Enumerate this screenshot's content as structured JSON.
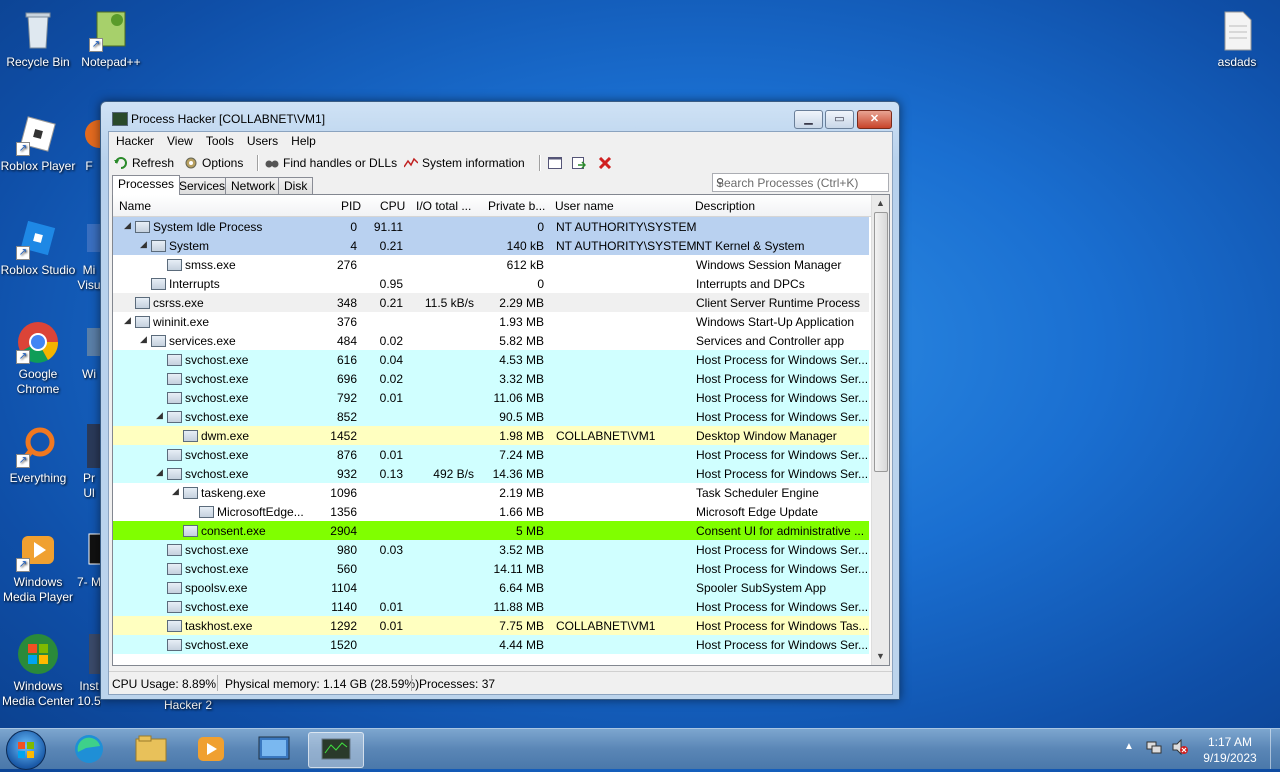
{
  "desktop": {
    "icons": [
      {
        "label": "Recycle Bin"
      },
      {
        "label": "Notepad++"
      },
      {
        "label": "asdads"
      },
      {
        "label": "Roblox Player"
      },
      {
        "label": "F"
      },
      {
        "label": "Roblox Studio"
      },
      {
        "label": "Mi Visu"
      },
      {
        "label": "Google Chrome"
      },
      {
        "label": "Wi"
      },
      {
        "label": "Everything"
      },
      {
        "label": "Pr Ul"
      },
      {
        "label": "Windows Media Player"
      },
      {
        "label": "7- M"
      },
      {
        "label": "Windows Media Center"
      },
      {
        "label": "Inst 10.5"
      },
      {
        "label": "Hacker 2"
      }
    ]
  },
  "window": {
    "title": "Process Hacker [COLLABNET\\VM1]",
    "menu": [
      "Hacker",
      "View",
      "Tools",
      "Users",
      "Help"
    ],
    "toolbar": {
      "refresh": "Refresh",
      "options": "Options",
      "find": "Find handles or DLLs",
      "sysinfo": "System information",
      "search_placeholder": "Search Processes (Ctrl+K)"
    },
    "tabs": [
      "Processes",
      "Services",
      "Network",
      "Disk"
    ],
    "columns": [
      "Name",
      "PID",
      "CPU",
      "I/O total ...",
      "Private b...",
      "User name",
      "Description"
    ],
    "rows": [
      {
        "name": "System Idle Process",
        "pid": "0",
        "cpu": "91.11",
        "io": "",
        "priv": "0",
        "user": "NT AUTHORITY\\SYSTEM",
        "desc": "",
        "indent": 1,
        "tri": true,
        "bg": "blue"
      },
      {
        "name": "System",
        "pid": "4",
        "cpu": "0.21",
        "io": "",
        "priv": "140 kB",
        "user": "NT AUTHORITY\\SYSTEM",
        "desc": "NT Kernel & System",
        "indent": 2,
        "tri": true,
        "bg": "blue"
      },
      {
        "name": "smss.exe",
        "pid": "276",
        "cpu": "",
        "io": "",
        "priv": "612 kB",
        "user": "",
        "desc": "Windows Session Manager",
        "indent": 3,
        "tri": false,
        "bg": "white"
      },
      {
        "name": "Interrupts",
        "pid": "",
        "cpu": "0.95",
        "io": "",
        "priv": "0",
        "user": "",
        "desc": "Interrupts and DPCs",
        "indent": 2,
        "tri": false,
        "bg": "white"
      },
      {
        "name": "csrss.exe",
        "pid": "348",
        "cpu": "0.21",
        "io": "11.5 kB/s",
        "priv": "2.29 MB",
        "user": "",
        "desc": "Client Server Runtime Process",
        "indent": 1,
        "tri": false,
        "bg": "gray"
      },
      {
        "name": "wininit.exe",
        "pid": "376",
        "cpu": "",
        "io": "",
        "priv": "1.93 MB",
        "user": "",
        "desc": "Windows Start-Up Application",
        "indent": 1,
        "tri": true,
        "bg": "white"
      },
      {
        "name": "services.exe",
        "pid": "484",
        "cpu": "0.02",
        "io": "",
        "priv": "5.82 MB",
        "user": "",
        "desc": "Services and Controller app",
        "indent": 2,
        "tri": true,
        "bg": "white"
      },
      {
        "name": "svchost.exe",
        "pid": "616",
        "cpu": "0.04",
        "io": "",
        "priv": "4.53 MB",
        "user": "",
        "desc": "Host Process for Windows Ser...",
        "indent": 3,
        "tri": false,
        "bg": "cyan"
      },
      {
        "name": "svchost.exe",
        "pid": "696",
        "cpu": "0.02",
        "io": "",
        "priv": "3.32 MB",
        "user": "",
        "desc": "Host Process for Windows Ser...",
        "indent": 3,
        "tri": false,
        "bg": "cyan"
      },
      {
        "name": "svchost.exe",
        "pid": "792",
        "cpu": "0.01",
        "io": "",
        "priv": "11.06 MB",
        "user": "",
        "desc": "Host Process for Windows Ser...",
        "indent": 3,
        "tri": false,
        "bg": "cyan"
      },
      {
        "name": "svchost.exe",
        "pid": "852",
        "cpu": "",
        "io": "",
        "priv": "90.5 MB",
        "user": "",
        "desc": "Host Process for Windows Ser...",
        "indent": 3,
        "tri": true,
        "bg": "cyan"
      },
      {
        "name": "dwm.exe",
        "pid": "1452",
        "cpu": "",
        "io": "",
        "priv": "1.98 MB",
        "user": "COLLABNET\\VM1",
        "desc": "Desktop Window Manager",
        "indent": 4,
        "tri": false,
        "bg": "yellow"
      },
      {
        "name": "svchost.exe",
        "pid": "876",
        "cpu": "0.01",
        "io": "",
        "priv": "7.24 MB",
        "user": "",
        "desc": "Host Process for Windows Ser...",
        "indent": 3,
        "tri": false,
        "bg": "cyan"
      },
      {
        "name": "svchost.exe",
        "pid": "932",
        "cpu": "0.13",
        "io": "492 B/s",
        "priv": "14.36 MB",
        "user": "",
        "desc": "Host Process for Windows Ser...",
        "indent": 3,
        "tri": true,
        "bg": "cyan"
      },
      {
        "name": "taskeng.exe",
        "pid": "1096",
        "cpu": "",
        "io": "",
        "priv": "2.19 MB",
        "user": "",
        "desc": "Task Scheduler Engine",
        "indent": 4,
        "tri": true,
        "bg": "white"
      },
      {
        "name": "MicrosoftEdge...",
        "pid": "1356",
        "cpu": "",
        "io": "",
        "priv": "1.66 MB",
        "user": "",
        "desc": "Microsoft Edge Update",
        "indent": 5,
        "tri": false,
        "bg": "white"
      },
      {
        "name": "consent.exe",
        "pid": "2904",
        "cpu": "",
        "io": "",
        "priv": "5 MB",
        "user": "",
        "desc": "Consent UI for administrative ...",
        "indent": 4,
        "tri": false,
        "bg": "green"
      },
      {
        "name": "svchost.exe",
        "pid": "980",
        "cpu": "0.03",
        "io": "",
        "priv": "3.52 MB",
        "user": "",
        "desc": "Host Process for Windows Ser...",
        "indent": 3,
        "tri": false,
        "bg": "cyan"
      },
      {
        "name": "svchost.exe",
        "pid": "560",
        "cpu": "",
        "io": "",
        "priv": "14.11 MB",
        "user": "",
        "desc": "Host Process for Windows Ser...",
        "indent": 3,
        "tri": false,
        "bg": "cyan"
      },
      {
        "name": "spoolsv.exe",
        "pid": "1104",
        "cpu": "",
        "io": "",
        "priv": "6.64 MB",
        "user": "",
        "desc": "Spooler SubSystem App",
        "indent": 3,
        "tri": false,
        "bg": "cyan"
      },
      {
        "name": "svchost.exe",
        "pid": "1140",
        "cpu": "0.01",
        "io": "",
        "priv": "11.88 MB",
        "user": "",
        "desc": "Host Process for Windows Ser...",
        "indent": 3,
        "tri": false,
        "bg": "cyan"
      },
      {
        "name": "taskhost.exe",
        "pid": "1292",
        "cpu": "0.01",
        "io": "",
        "priv": "7.75 MB",
        "user": "COLLABNET\\VM1",
        "desc": "Host Process for Windows Tas...",
        "indent": 3,
        "tri": false,
        "bg": "yellow"
      },
      {
        "name": "svchost.exe",
        "pid": "1520",
        "cpu": "",
        "io": "",
        "priv": "4.44 MB",
        "user": "",
        "desc": "Host Process for Windows Ser...",
        "indent": 3,
        "tri": false,
        "bg": "cyan"
      }
    ],
    "status": {
      "cpu": "CPU Usage: 8.89%",
      "memory": "Physical memory: 1.14 GB (28.59%)",
      "processes": "Processes: 37"
    }
  },
  "taskbar": {
    "time": "1:17 AM",
    "date": "9/19/2023"
  },
  "colors": {
    "row_blue": "#b9d1f0",
    "row_cyan": "#d0ffff",
    "row_yellow": "#ffffc0",
    "row_green": "#80ff00"
  }
}
